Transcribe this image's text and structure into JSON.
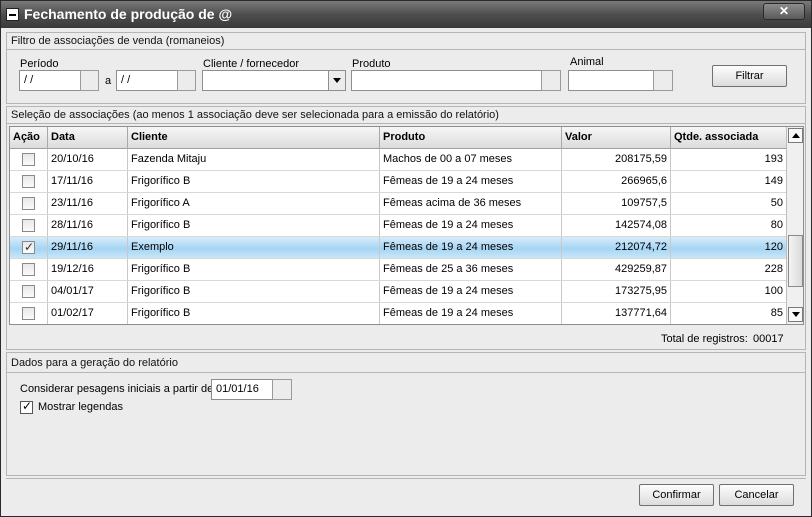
{
  "window": {
    "title": "Fechamento de produção de @",
    "close_label": "✕"
  },
  "filter": {
    "header": "Filtro de associações de venda (romaneios)",
    "periodo_label": "Período",
    "date_from": " / /",
    "a_label": "a",
    "date_to": " / /",
    "cliente_label": "Cliente / fornecedor",
    "cliente_value": "",
    "produto_label": "Produto",
    "produto_value": "",
    "animal_label": "Animal",
    "animal_value": "",
    "filtrar_label": "Filtrar"
  },
  "selection": {
    "header": "Seleção de associações (ao menos 1 associação deve ser selecionada para a emissão do relatório)",
    "columns": [
      "Ação",
      "Data",
      "Cliente",
      "Produto",
      "Valor",
      "Qtde. associada"
    ],
    "rows": [
      {
        "checked": false,
        "data": "20/10/16",
        "cliente": "Fazenda Mitaju",
        "produto": "Machos de 00 a 07 meses",
        "valor": "208175,59",
        "qtde": "193"
      },
      {
        "checked": false,
        "data": "17/11/16",
        "cliente": "Frigorífico B",
        "produto": "Fêmeas de 19 a 24 meses",
        "valor": "266965,6",
        "qtde": "149"
      },
      {
        "checked": false,
        "data": "23/11/16",
        "cliente": "Frigorífico A",
        "produto": "Fêmeas acima de 36 meses",
        "valor": "109757,5",
        "qtde": "50"
      },
      {
        "checked": false,
        "data": "28/11/16",
        "cliente": "Frigorífico B",
        "produto": "Fêmeas de 19 a 24 meses",
        "valor": "142574,08",
        "qtde": "80"
      },
      {
        "checked": true,
        "data": "29/11/16",
        "cliente": "Exemplo",
        "produto": "Fêmeas de 19 a 24 meses",
        "valor": "212074,72",
        "qtde": "120"
      },
      {
        "checked": false,
        "data": "19/12/16",
        "cliente": "Frigorífico B",
        "produto": "Fêmeas de 25 a 36 meses",
        "valor": "429259,87",
        "qtde": "228"
      },
      {
        "checked": false,
        "data": "04/01/17",
        "cliente": "Frigorífico B",
        "produto": "Fêmeas de 19 a 24 meses",
        "valor": "173275,95",
        "qtde": "100"
      },
      {
        "checked": false,
        "data": "01/02/17",
        "cliente": "Frigorífico B",
        "produto": "Fêmeas de 19 a 24 meses",
        "valor": "137771,64",
        "qtde": "85"
      }
    ],
    "selected_index": 4,
    "total_label": "Total de registros:",
    "total_value": "00017"
  },
  "report": {
    "header": "Dados para a geração do relatório",
    "pesagens_label": "Considerar pesagens iniciais a partir de:",
    "pesagens_value": "01/01/16",
    "legendas_label": "Mostrar legendas",
    "legendas_checked": true
  },
  "footer": {
    "confirmar_label": "Confirmar",
    "cancelar_label": "Cancelar"
  }
}
